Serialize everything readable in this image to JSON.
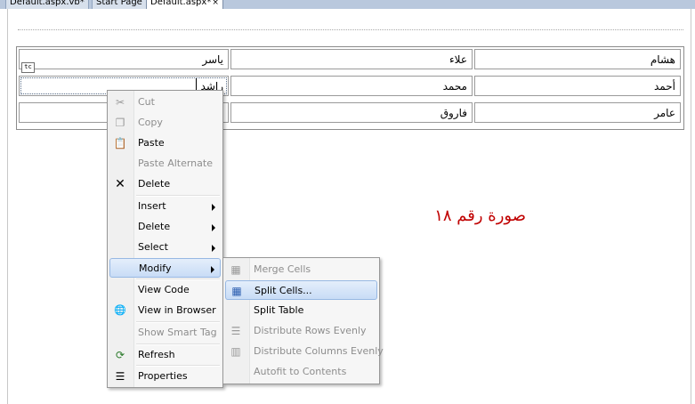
{
  "tabs": [
    {
      "label": "Default.aspx.vb*",
      "close": ""
    },
    {
      "label": "Start Page",
      "close": ""
    },
    {
      "label": "Default.aspx*",
      "close": "×"
    }
  ],
  "table": {
    "rows": [
      [
        "هشام",
        "علاء",
        "ياسر"
      ],
      [
        "أحمد",
        "محمد",
        "راشد"
      ],
      [
        "عامر",
        "فاروق",
        ""
      ]
    ],
    "smart_tag": "tc"
  },
  "caption": "صورة رقم ١٨",
  "context_menu": {
    "items": {
      "cut": "Cut",
      "copy": "Copy",
      "paste": "Paste",
      "paste_alternate": "Paste Alternate",
      "delete": "Delete",
      "insert": "Insert",
      "delete_sub": "Delete",
      "select": "Select",
      "modify": "Modify",
      "view_code": "View Code",
      "view_in_browser": "View in Browser",
      "show_smart_tag": "Show Smart Tag",
      "refresh": "Refresh",
      "properties": "Properties"
    }
  },
  "modify_submenu": {
    "items": {
      "merge_cells": "Merge Cells",
      "split_cells": "Split Cells...",
      "split_table": "Split Table",
      "distribute_rows": "Distribute Rows Evenly",
      "distribute_columns": "Distribute Columns Evenly",
      "autofit": "Autofit to Contents"
    }
  },
  "icons": {
    "cut": "✂",
    "copy": "❐",
    "paste": "📋",
    "delete": "✕",
    "view_in_browser": "🌐",
    "refresh": "⟳",
    "properties": "☰",
    "merge_cells": "▦",
    "split_cells": "▦",
    "distribute_rows": "☰",
    "distribute_columns": "▥"
  },
  "colors": {
    "caption": "#c00000",
    "highlight_border": "#97b8e3"
  }
}
